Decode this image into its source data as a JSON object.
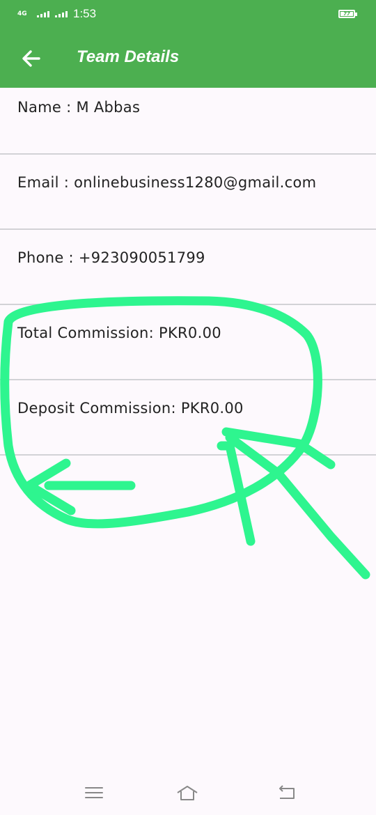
{
  "status_bar": {
    "network": "4G",
    "time": "1:53",
    "battery": "77"
  },
  "app_bar": {
    "title": "Team Details",
    "back_icon": "arrow-left-icon"
  },
  "details": [
    {
      "label": "Name : M Abbas"
    },
    {
      "label": "Email : onlinebusiness1280@gmail.com"
    },
    {
      "label": "Phone : +923090051799"
    },
    {
      "label": "Total Commission: PKR0.00"
    },
    {
      "label": "Deposit Commission: PKR0.00"
    }
  ],
  "annotation": {
    "color": "#2ef58f",
    "description_shapes": [
      "circle-scribble",
      "arrow-left",
      "arrow-up-left"
    ]
  },
  "nav_bar": {
    "icons": [
      "menu-icon",
      "home-icon",
      "back-icon"
    ]
  },
  "colors": {
    "primary": "#4caf50",
    "background": "#fdf9fd",
    "divider": "#d2d2d6",
    "annotation": "#2ef58f"
  }
}
